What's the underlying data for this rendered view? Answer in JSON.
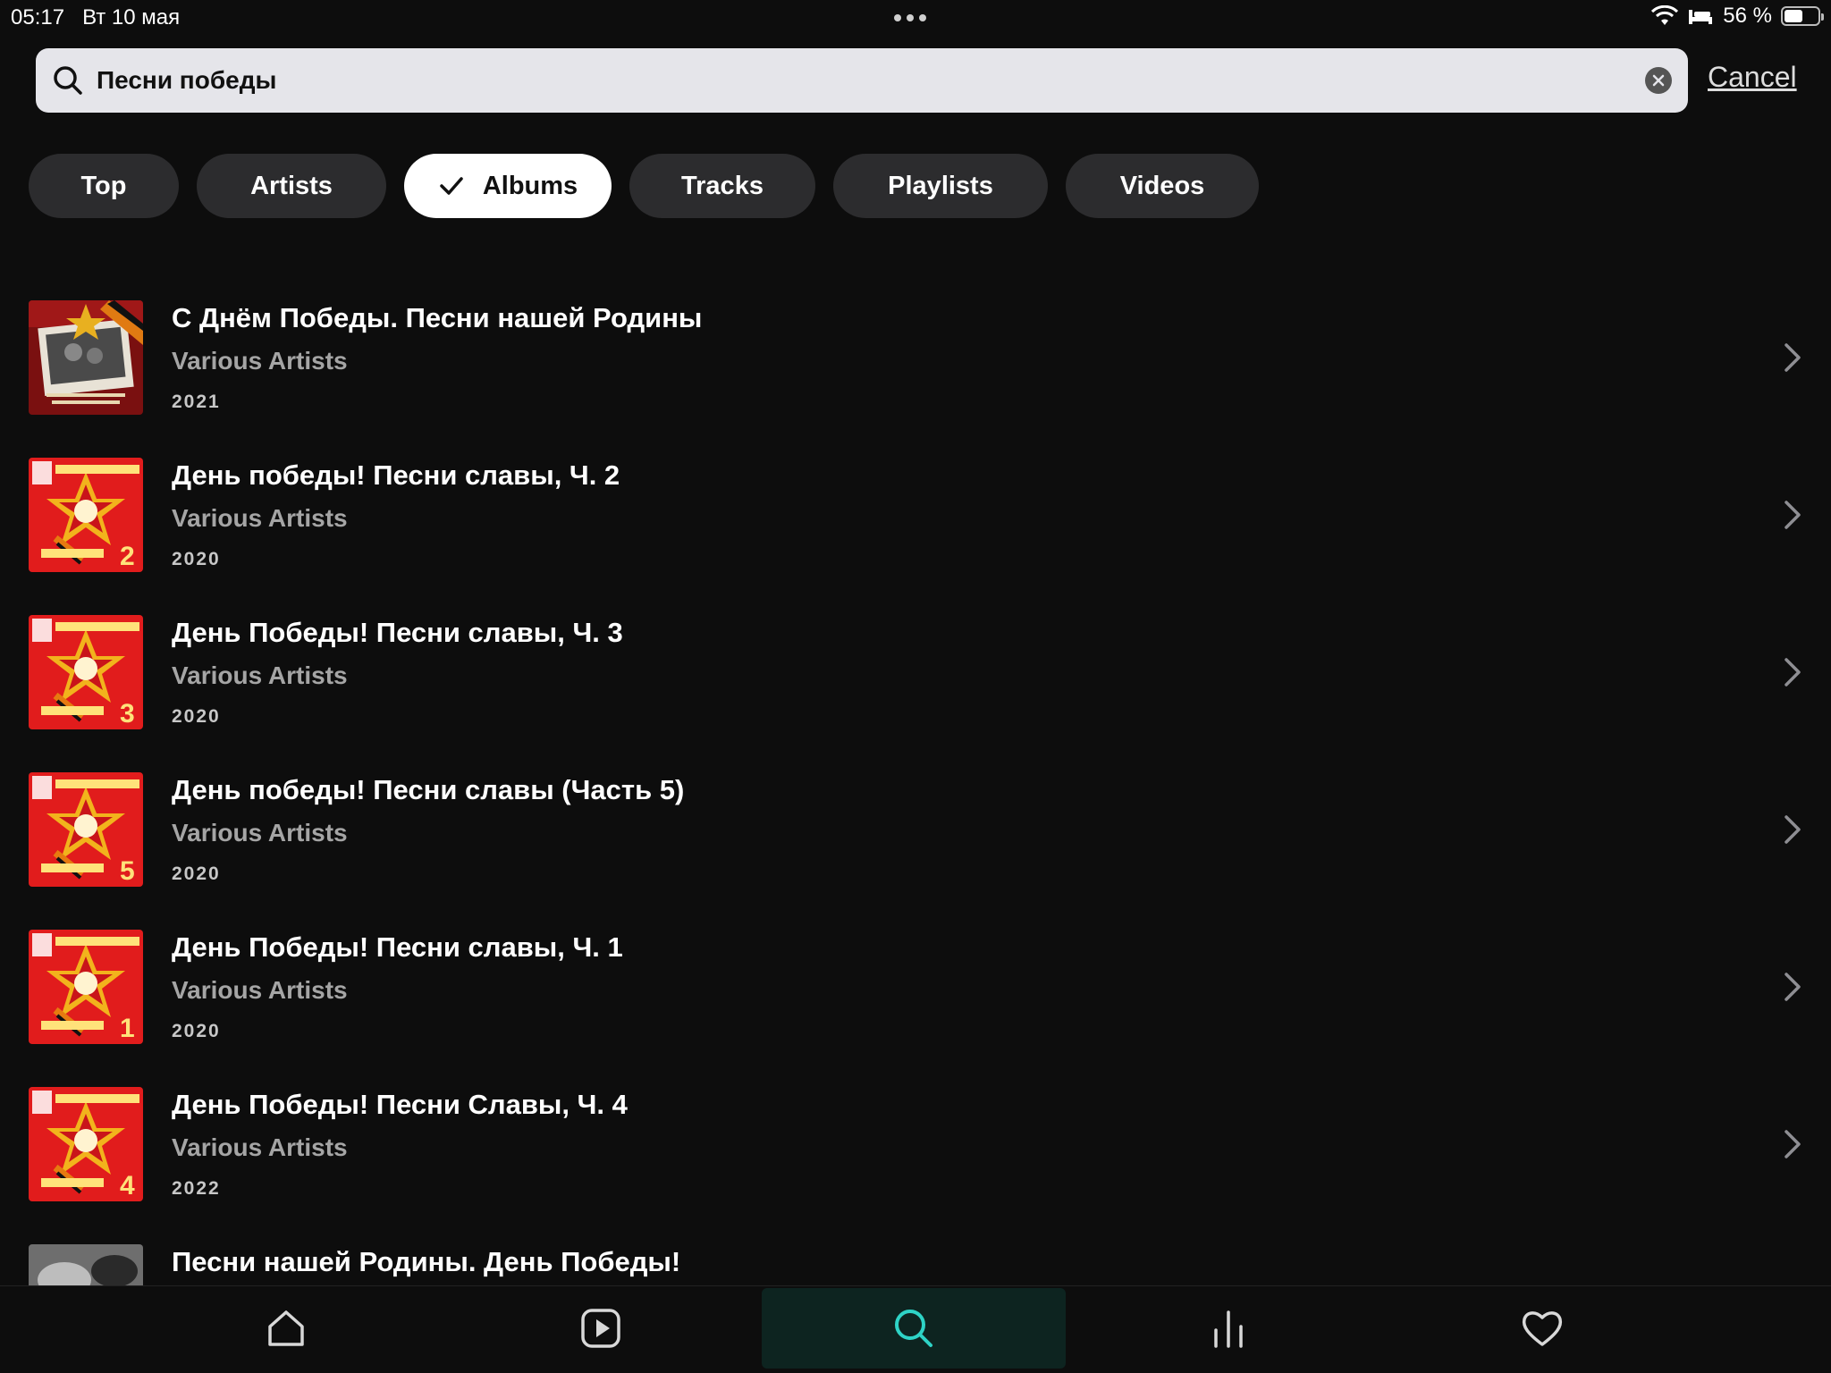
{
  "status": {
    "time": "05:17",
    "date": "Вт 10 мая",
    "battery": "56 %",
    "battery_level": 0.56
  },
  "search": {
    "value": "Песни победы",
    "placeholder": "",
    "cancel_label": "Cancel"
  },
  "filters": [
    {
      "label": "Top",
      "active": false
    },
    {
      "label": "Artists",
      "active": false
    },
    {
      "label": "Albums",
      "active": true
    },
    {
      "label": "Tracks",
      "active": false
    },
    {
      "label": "Playlists",
      "active": false
    },
    {
      "label": "Videos",
      "active": false
    }
  ],
  "albums": [
    {
      "title": "С Днём Победы. Песни нашей Родины",
      "artist": "Various Artists",
      "year": "2021",
      "cover": "photo-frame"
    },
    {
      "title": "День победы! Песни славы, Ч. 2",
      "artist": "Various Artists",
      "year": "2020",
      "cover": "red-order",
      "cover_number": "2"
    },
    {
      "title": "День Победы! Песни славы, Ч. 3",
      "artist": "Various Artists",
      "year": "2020",
      "cover": "red-order",
      "cover_number": "3"
    },
    {
      "title": "День победы! Песни славы (Часть 5)",
      "artist": "Various Artists",
      "year": "2020",
      "cover": "red-order",
      "cover_number": "5"
    },
    {
      "title": "День Победы! Песни славы, Ч. 1",
      "artist": "Various Artists",
      "year": "2020",
      "cover": "red-order",
      "cover_number": "1"
    },
    {
      "title": "День Победы! Песни Славы, Ч. 4",
      "artist": "Various Artists",
      "year": "2022",
      "cover": "red-order",
      "cover_number": "4"
    },
    {
      "title": "Песни нашей Родины. День Победы!",
      "artist": "",
      "year": "",
      "cover": "bw-photo"
    }
  ],
  "nav": [
    {
      "icon": "home-icon",
      "active": false
    },
    {
      "icon": "video-icon",
      "active": false
    },
    {
      "icon": "search-icon",
      "active": true
    },
    {
      "icon": "stats-icon",
      "active": false
    },
    {
      "icon": "heart-icon",
      "active": false
    }
  ],
  "colors": {
    "background": "#0d0d0d",
    "chip": "#2c2c2e",
    "accent": "#2ed3c6"
  }
}
